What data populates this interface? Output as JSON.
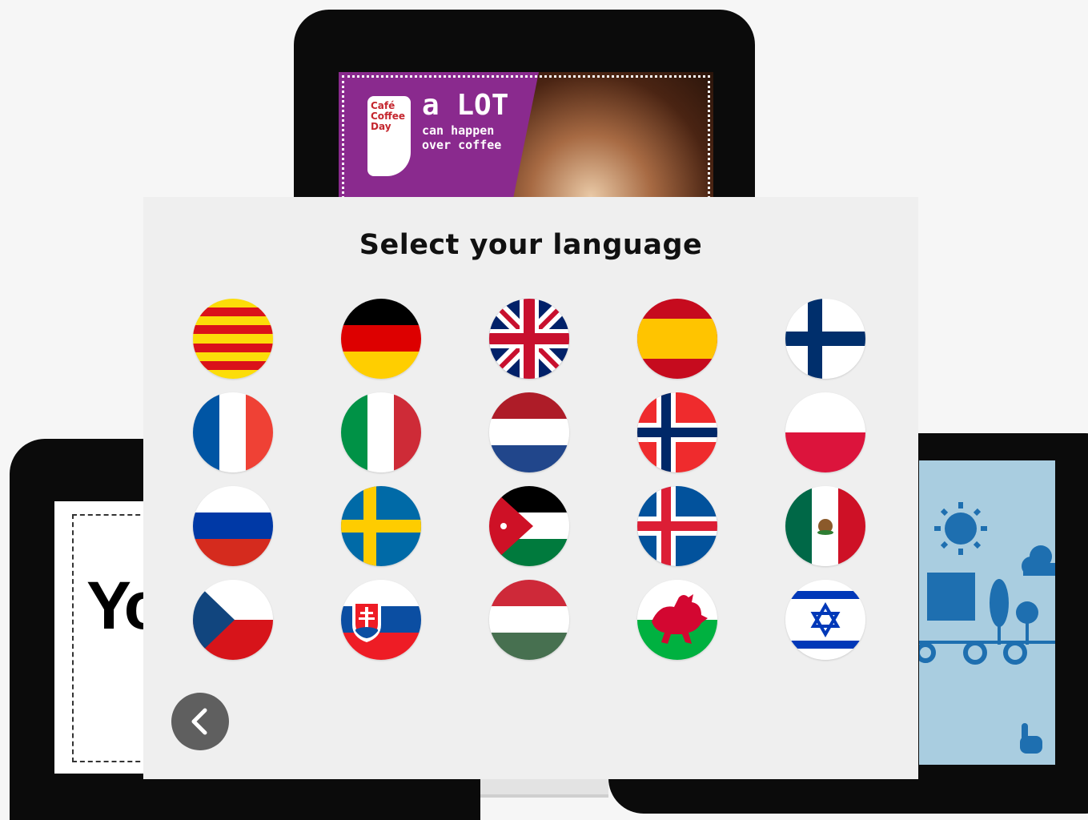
{
  "dialog": {
    "title": "Select your language"
  },
  "languages": [
    {
      "flag_icon": "catalonia-flag-icon"
    },
    {
      "flag_icon": "germany-flag-icon"
    },
    {
      "flag_icon": "united-kingdom-flag-icon"
    },
    {
      "flag_icon": "spain-flag-icon"
    },
    {
      "flag_icon": "finland-flag-icon"
    },
    {
      "flag_icon": "france-flag-icon"
    },
    {
      "flag_icon": "italy-flag-icon"
    },
    {
      "flag_icon": "netherlands-flag-icon"
    },
    {
      "flag_icon": "norway-flag-icon"
    },
    {
      "flag_icon": "poland-flag-icon"
    },
    {
      "flag_icon": "russia-flag-icon"
    },
    {
      "flag_icon": "sweden-flag-icon"
    },
    {
      "flag_icon": "jordan-flag-icon"
    },
    {
      "flag_icon": "iceland-flag-icon"
    },
    {
      "flag_icon": "mexico-flag-icon"
    },
    {
      "flag_icon": "czech-republic-flag-icon"
    },
    {
      "flag_icon": "slovakia-flag-icon"
    },
    {
      "flag_icon": "hungary-flag-icon"
    },
    {
      "flag_icon": "wales-flag-icon"
    },
    {
      "flag_icon": "israel-flag-icon"
    }
  ],
  "back_icon": "chevron-left-icon",
  "background": {
    "top_ad": {
      "logo_text": "Café Coffee Day",
      "headline": "a LOT",
      "tagline": "can happen over coffee"
    },
    "left_screen_text": "Yo"
  },
  "colors": {
    "dialog_bg": "#efefef",
    "back_button_bg": "#5f5f5f",
    "page_bg": "#f6f6f6"
  }
}
